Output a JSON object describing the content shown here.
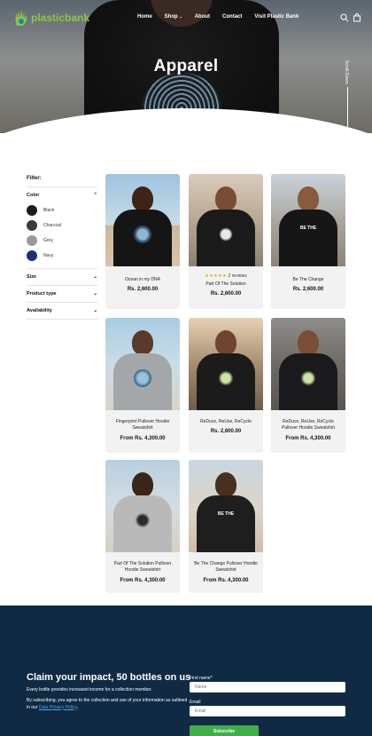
{
  "brand": {
    "name": "plasticbank",
    "accent": "#8cc63f"
  },
  "nav": {
    "links": [
      "Home",
      "Shop",
      "About",
      "Contact",
      "Visit Plastic Bank"
    ],
    "icons": [
      "search-icon",
      "cart-icon"
    ]
  },
  "hero": {
    "title": "Apparel",
    "scroll_label": "Scroll Down"
  },
  "filters": {
    "title": "Filter:",
    "color": {
      "label": "Color",
      "options": [
        {
          "label": "Black",
          "hex": "#1c1c1c"
        },
        {
          "label": "Charcoal",
          "hex": "#3b3b3d"
        },
        {
          "label": "Grey",
          "hex": "#9a9a9a"
        },
        {
          "label": "Navy",
          "hex": "#24306b"
        }
      ]
    },
    "size": "Size",
    "product_type": "Product type",
    "availability": "Availability"
  },
  "products": [
    {
      "name": "Ocean in my DNA",
      "price": "Rs. 2,600.00"
    },
    {
      "name": "Part Of The Solution",
      "price": "Rs. 2,600.00",
      "stars": "★★★★★",
      "reviews": "2 reviews"
    },
    {
      "name": "Be The Change",
      "price": "Rs. 2,600.00"
    },
    {
      "name": "Fingerprint Pullover Hoodie Sweatshirt",
      "price": "From Rs. 4,300.00"
    },
    {
      "name": "ReDuce, ReUse, ReCycle",
      "price": "Rs. 2,600.00"
    },
    {
      "name": "ReDuce, ReUse, ReCycle Pullover Hoodie Sweatshirt",
      "price": "From Rs. 4,300.00"
    },
    {
      "name": "Part Of The Solution Pullover Hoodie Sweatshirt",
      "price": "From Rs. 4,300.00"
    },
    {
      "name": "Be The Change Pullover Hoodie Sweatshirt",
      "price": "From Rs. 4,300.00"
    }
  ],
  "footer": {
    "heading": "Claim your impact, 50 bottles on us",
    "p1": "Every bottle provides increased income for a collection member.",
    "p2_prefix": "By subscribing, you agree to the collection and use of your information as outlined in our ",
    "p2_link": "Data Privacy Policy",
    "p2_suffix": ".",
    "first_name_label": "First name*",
    "first_name_placeholder": "Name",
    "email_label": "Email",
    "email_placeholder": "Email",
    "subscribe": "Subscribe",
    "bg": "#102a44"
  }
}
